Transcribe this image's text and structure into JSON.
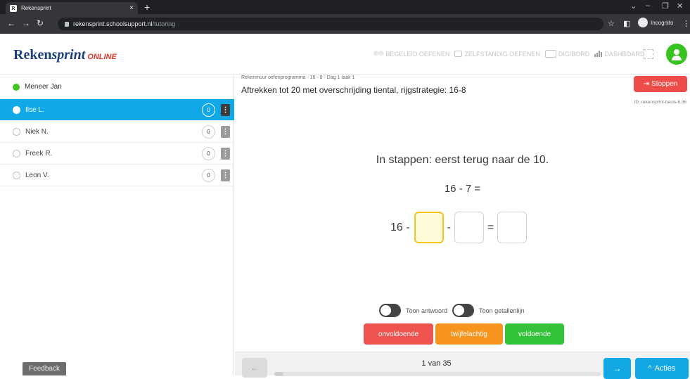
{
  "browser": {
    "tab_title": "Rekensprint",
    "tab_close": "×",
    "new_tab": "+",
    "url_host": "rekensprint.schoolsupport.nl",
    "url_path": "/tutoring",
    "incognito_label": "Incognito"
  },
  "header": {
    "logo_main": "Reken",
    "logo_sprint": "sprint",
    "logo_online": "ONLINE",
    "nav": [
      {
        "label": "BEGELEID OEFENEN",
        "icon": "guided-practice-icon"
      },
      {
        "label": "ZELFSTANDIG OEFENEN",
        "icon": "laptop-icon"
      },
      {
        "label": "DIGIBORD",
        "icon": "whiteboard-icon"
      },
      {
        "label": "DASHBOARD",
        "icon": "bar-chart-icon"
      }
    ]
  },
  "sidebar": {
    "teacher": "Meneer Jan",
    "students": [
      {
        "name": "Ilse L.",
        "count": "0",
        "active": true
      },
      {
        "name": "Niek N.",
        "count": "0",
        "active": false
      },
      {
        "name": "Freek R.",
        "count": "0",
        "active": false
      },
      {
        "name": "Leon V.",
        "count": "0",
        "active": false
      }
    ],
    "feedback_label": "Feedback"
  },
  "main": {
    "breadcrumb": "Rekenmuur oefenprogramma - 16 - 8 - Dag 1 taak 1",
    "title": "Aftrekken tot 20 met overschrijding tiental, rijgstrategie: 16-8",
    "stop_label": "Stoppen",
    "exercise_id": "ID: rekensprint-basis-6.36",
    "instruction": "In stappen: eerst terug naar de 10.",
    "problem": "16 - 7 =",
    "equation": {
      "start": "16 -",
      "op1": "-",
      "op2": "="
    },
    "toggles": [
      {
        "label": "Toon antwoord",
        "on": false
      },
      {
        "label": "Toon getallenlijn",
        "on": false
      }
    ],
    "ratings": [
      "onvoldoende",
      "twijfelachtig",
      "voldoende"
    ],
    "pagination": {
      "text": "1 van 35",
      "progress": 0.0286
    },
    "acties_label": "Acties"
  },
  "colors": {
    "accent_blue": "#10a8e6",
    "stop_red": "#ee4b4b",
    "online_green": "#41c621",
    "rate_bad": "#ef5350",
    "rate_doubt": "#f7941d",
    "rate_good": "#33c33a"
  }
}
